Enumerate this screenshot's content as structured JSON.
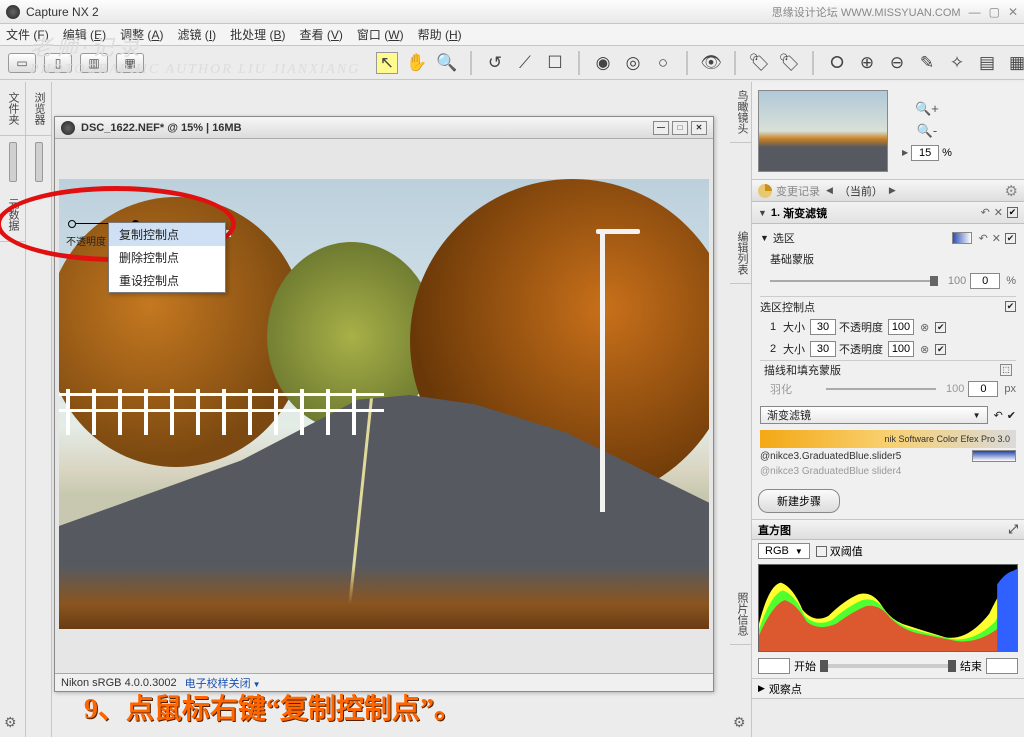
{
  "title": "Capture NX 2",
  "watermark_site": "思缘设计论坛  WWW.MISSYUAN.COM",
  "watermark1": "老师·记录",
  "watermark2": "PHOTOGRAPHIC AUTHOR LIU JIANXIANG",
  "menu": [
    {
      "label": "文件",
      "key": "F"
    },
    {
      "label": "编辑",
      "key": "E"
    },
    {
      "label": "调整",
      "key": "A"
    },
    {
      "label": "滤镜",
      "key": "I"
    },
    {
      "label": "批处理",
      "key": "B"
    },
    {
      "label": "查看",
      "key": "V"
    },
    {
      "label": "窗口",
      "key": "W"
    },
    {
      "label": "帮助",
      "key": "H"
    }
  ],
  "left_tabs": {
    "browser": "浏览器",
    "folders": "文件夹",
    "metadata": "元数据"
  },
  "doc": {
    "title": "DSC_1622.NEF* @ 15% | 16MB",
    "footer_profile": "Nikon sRGB 4.0.0.3002",
    "footer_softproof": "电子校样关闭"
  },
  "ctx": {
    "label": "不透明度",
    "copy": "复制控制点",
    "delete": "删除控制点",
    "reset": "重设控制点"
  },
  "caption": "9、点鼠标右键“复制控制点”。",
  "right_tabs": {
    "birdeye": "鸟瞰镜头",
    "editlist": "编辑列表",
    "photoinfo": "照片信息"
  },
  "zoom": {
    "value": "15",
    "unit": "%"
  },
  "editlist": {
    "hdr_title": "变更记录",
    "hdr_current": "（当前）",
    "step1": {
      "num": "1.",
      "name": "渐变滤镜"
    },
    "selection": {
      "title": "选区",
      "base_mask": "基础蒙版",
      "base_val": "0",
      "base_unit": "%",
      "base_max": "100",
      "cp_title": "选区控制点",
      "cp": [
        {
          "idx": "1",
          "size_label": "大小",
          "size": "30",
          "opacity_label": "不透明度",
          "opacity": "100"
        },
        {
          "idx": "2",
          "size_label": "大小",
          "size": "30",
          "opacity_label": "不透明度",
          "opacity": "100"
        }
      ],
      "edge_title": "描线和填充蒙版",
      "feather_label": "羽化",
      "feather_val": "0",
      "feather_unit": "px",
      "feather_max": "100"
    },
    "filter_dd": "渐变滤镜",
    "nik_brand": "nik Software   Color Efex Pro 3.0",
    "preset1": "@nikce3.GraduatedBlue.slider5",
    "preset2": "@nikce3 GraduatedBlue slider4",
    "newstep": "新建步骤"
  },
  "histo": {
    "title": "直方图",
    "channel": "RGB",
    "dual": "双阈值",
    "start_label": "开始",
    "end_label": "结束",
    "start": "",
    "end": "",
    "watch": "观察点"
  }
}
